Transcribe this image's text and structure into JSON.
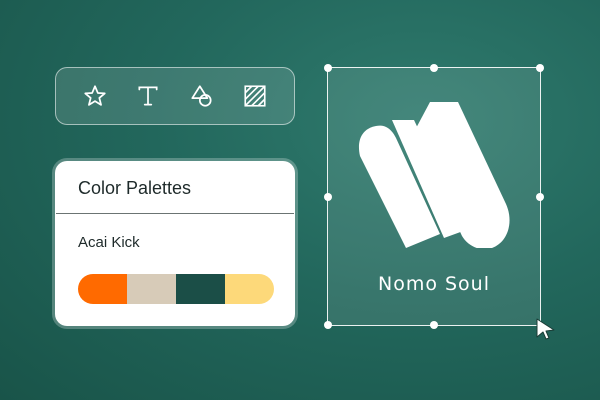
{
  "toolbar": {
    "tools": [
      {
        "icon": "star-icon"
      },
      {
        "icon": "text-icon"
      },
      {
        "icon": "shapes-icon"
      },
      {
        "icon": "pattern-icon"
      }
    ]
  },
  "palette_panel": {
    "title": "Color Palettes",
    "palette_name": "Acai Kick",
    "swatches": [
      "#ff6a00",
      "#d7cbb8",
      "#1b4e47",
      "#fdd97a"
    ]
  },
  "canvas": {
    "logo_text": "Nomo Soul",
    "logo_icon": "nomo-soul-logo-icon"
  },
  "colors": {
    "background": "#22675c",
    "accent": "#ff6a00"
  }
}
